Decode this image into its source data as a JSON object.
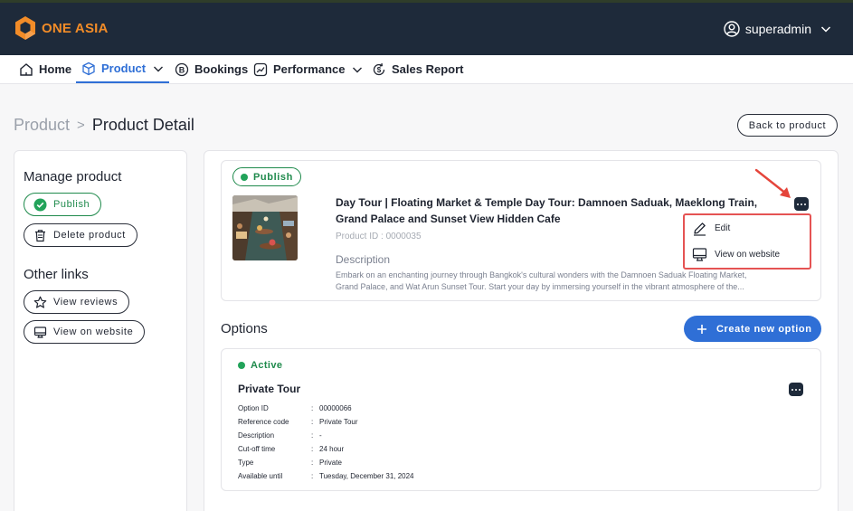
{
  "brand": {
    "name": "ONE ASIA",
    "accent": "#f28c28",
    "primary": "#2f6fd6",
    "success": "#1f8a4c",
    "header_bg": "#1e2a3a"
  },
  "user": {
    "name": "superadmin"
  },
  "nav": {
    "home": "Home",
    "product": "Product",
    "bookings": "Bookings",
    "performance": "Performance",
    "sales_report": "Sales Report"
  },
  "breadcrumb": {
    "parent": "Product",
    "separator": ">",
    "current": "Product Detail"
  },
  "back_button": "Back to product",
  "sidebar": {
    "manage_title": "Manage product",
    "publish_label": "Publish",
    "delete_label": "Delete product",
    "other_title": "Other links",
    "view_reviews_label": "View reviews",
    "view_website_label": "View on website"
  },
  "product": {
    "status": "Publish",
    "title": "Day Tour | Floating Market & Temple Day Tour: Damnoen Saduak, Maeklong Train, Grand Palace and Sunset View Hidden Cafe",
    "product_id_label": "Product ID : 0000035",
    "description_label": "Description",
    "description": "Embark on an enchanting journey through Bangkok's cultural wonders with the Damnoen Saduak Floating Market, Grand Palace, and Wat Arun Sunset Tour. Start your day by immersing yourself in the vibrant atmosphere of the..."
  },
  "context_menu": {
    "edit": "Edit",
    "view_on_website": "View on website"
  },
  "options": {
    "heading": "Options",
    "create_label": "Create new option",
    "card": {
      "status": "Active",
      "title": "Private Tour",
      "fields": [
        {
          "key": "Option ID",
          "value": "00000066"
        },
        {
          "key": "Reference code",
          "value": "Private Tour"
        },
        {
          "key": "Description",
          "value": "-"
        },
        {
          "key": "Cut-off time",
          "value": "24 hour"
        },
        {
          "key": "Type",
          "value": "Private"
        },
        {
          "key": "Available until",
          "value": "Tuesday, December 31, 2024"
        }
      ]
    }
  }
}
